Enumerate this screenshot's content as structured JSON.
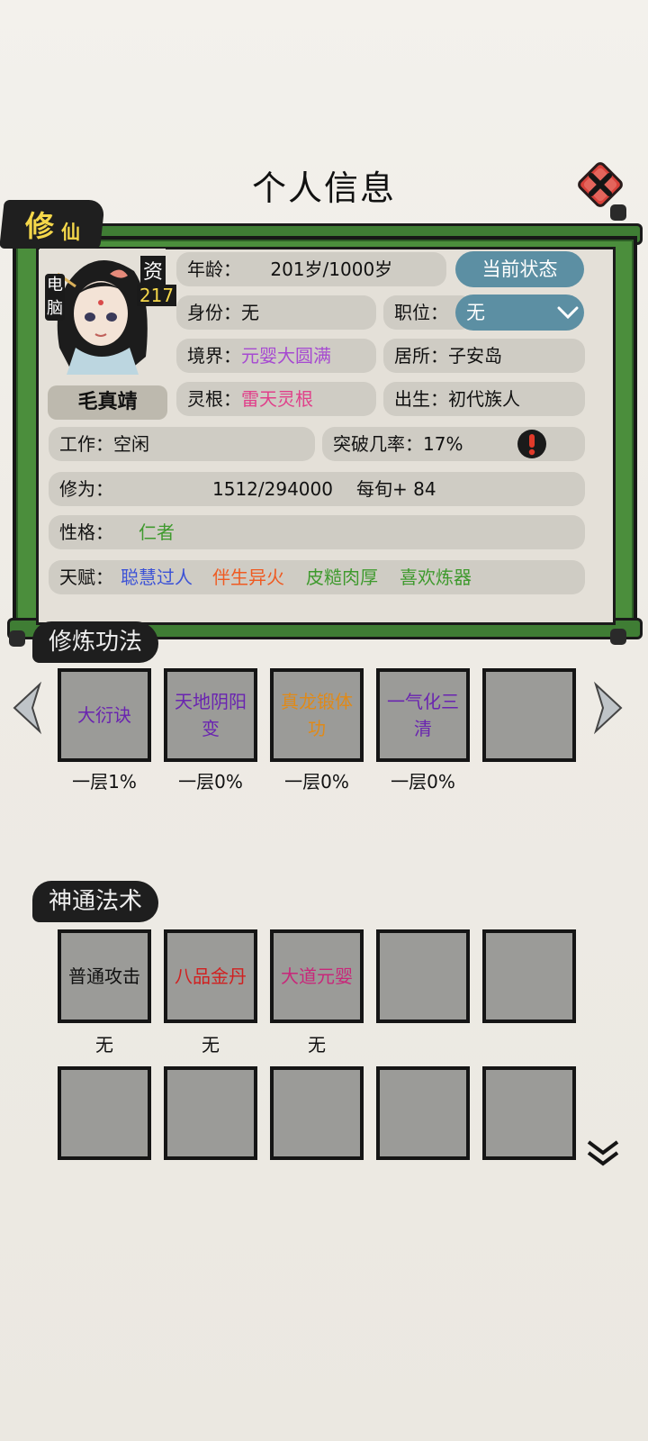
{
  "page_title": "个人信息",
  "header_tab": {
    "main": "修",
    "sub": "仙"
  },
  "avatar": {
    "badge_left": "电\n脑",
    "badge_aptitude_label": "资",
    "badge_aptitude_value": "217"
  },
  "character_name": "毛真靖",
  "info": {
    "age_label": "年龄：",
    "age_value": "201岁/1000岁",
    "status_button": "当前状态",
    "identity_label": "身份：",
    "identity_value": "无",
    "position_label": "职位：",
    "position_value": "无",
    "realm_label": "境界：",
    "realm_value": "元婴大圆满",
    "residence_label": "居所：",
    "residence_value": "子安岛",
    "spirit_root_label": "灵根：",
    "spirit_root_value": "雷天灵根",
    "birth_label": "出生：",
    "birth_value": "初代族人",
    "work_label": "工作：",
    "work_value": "空闲",
    "breakthrough_label": "突破几率：",
    "breakthrough_value": "17%",
    "cultivation_label": "修为：",
    "cultivation_value": "1512/294000",
    "cultivation_rate": "每旬+ 84",
    "personality_label": "性格：",
    "personality_value": "仁者",
    "talent_label": "天赋：",
    "talents": [
      "聪慧过人",
      "伴生异火",
      "皮糙肉厚",
      "喜欢炼器"
    ]
  },
  "colors": {
    "realm": "#a64ad1",
    "spirit_root": "#e0408a",
    "personality": "#3f9a2e",
    "talent1": "#3c52d6",
    "talent2": "#ef5a21",
    "talent3": "#3f9a2e",
    "talent4": "#3f9a2e",
    "scroll_green": "#4b8e3c",
    "accent_blue": "#5c8fa3"
  },
  "techniques": {
    "title": "修炼功法",
    "items": [
      {
        "name_line1": "大衍诀",
        "name_line2": "",
        "level": "一层1%"
      },
      {
        "name_line1": "天地阴阳",
        "name_line2": "变",
        "level": "一层0%"
      },
      {
        "name_line1": "真龙锻体",
        "name_line2": "功",
        "level": "一层0%"
      },
      {
        "name_line1": "一气化三",
        "name_line2": "清",
        "level": "一层0%"
      },
      {
        "name_line1": "",
        "name_line2": "",
        "level": ""
      }
    ]
  },
  "skills": {
    "title": "神通法术",
    "items": [
      {
        "name": "普通攻击",
        "level": "无"
      },
      {
        "name": "八品金丹",
        "level": "无"
      },
      {
        "name": "大道元婴",
        "level": "无"
      },
      {
        "name": "",
        "level": ""
      },
      {
        "name": "",
        "level": ""
      }
    ]
  }
}
